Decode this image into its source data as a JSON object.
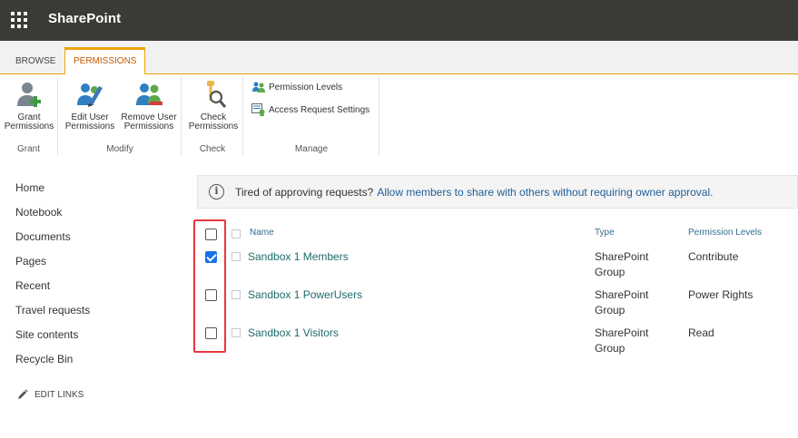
{
  "suite": {
    "brand": "SharePoint",
    "app_launcher_icon": "waffle-icon"
  },
  "ribbon": {
    "tabs": [
      {
        "label": "BROWSE",
        "active": false
      },
      {
        "label": "PERMISSIONS",
        "active": true
      }
    ],
    "groups": {
      "grant": {
        "label": "Grant",
        "buttons": [
          {
            "line1": "Grant",
            "line2": "Permissions",
            "icon": "grant-permissions-icon"
          }
        ]
      },
      "modify": {
        "label": "Modify",
        "buttons": [
          {
            "line1": "Edit User",
            "line2": "Permissions",
            "icon": "edit-user-permissions-icon"
          },
          {
            "line1": "Remove User",
            "line2": "Permissions",
            "icon": "remove-user-permissions-icon"
          }
        ]
      },
      "check": {
        "label": "Check",
        "buttons": [
          {
            "line1": "Check",
            "line2": "Permissions",
            "icon": "check-permissions-icon"
          }
        ]
      },
      "manage": {
        "label": "Manage",
        "items": [
          {
            "label": "Permission Levels",
            "icon": "permission-levels-icon"
          },
          {
            "label": "Access Request Settings",
            "icon": "access-request-settings-icon"
          }
        ]
      }
    }
  },
  "nav": {
    "items": [
      "Home",
      "Notebook",
      "Documents",
      "Pages",
      "Recent",
      "Travel requests",
      "Site contents",
      "Recycle Bin"
    ],
    "edit_links": "EDIT LINKS"
  },
  "info": {
    "message": "Tired of approving requests?",
    "link": "Allow members to share with others without requiring owner approval."
  },
  "table": {
    "headers": {
      "name": "Name",
      "type": "Type",
      "permission": "Permission Levels"
    },
    "rows": [
      {
        "name": "Sandbox 1 Members",
        "type_line1": "SharePoint",
        "type_line2": "Group",
        "permission": "Contribute",
        "checked": true
      },
      {
        "name": "Sandbox 1 PowerUsers",
        "type_line1": "SharePoint",
        "type_line2": "Group",
        "permission": "Power Rights",
        "checked": false
      },
      {
        "name": "Sandbox 1 Visitors",
        "type_line1": "SharePoint",
        "type_line2": "Group",
        "permission": "Read",
        "checked": false
      }
    ]
  },
  "colors": {
    "suite_bar": "#3c3a37",
    "accent": "#f0a30a",
    "link": "#1e6b6b",
    "highlight": "#e8373e",
    "checkbox_checked": "#1a73e8"
  }
}
